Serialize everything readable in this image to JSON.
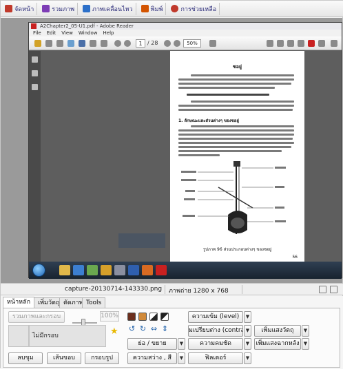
{
  "top_tabs": [
    {
      "label": "จัดหน้า",
      "icon": "layout-icon",
      "color": "#c0392b"
    },
    {
      "label": "รวมภาพ",
      "icon": "combine-icon",
      "color": "#7d3cb5"
    },
    {
      "label": "ภาพเคลื่อนไหว",
      "icon": "animation-icon",
      "color": "#2c70c9"
    },
    {
      "label": "พิมพ์",
      "icon": "print-icon",
      "color": "#d35400"
    },
    {
      "label": "การช่วยเหลือ",
      "icon": "help-icon",
      "color": "#c0392b"
    }
  ],
  "reader": {
    "title": "A2Chapter2_05-U1.pdf - Adobe Reader",
    "menu": [
      "File",
      "Edit",
      "View",
      "Window",
      "Help"
    ],
    "page_current": "1",
    "page_total": "/ 28",
    "zoom": "50%",
    "heading": "ซอยู่",
    "subheading": "1.  ลักษณะและส่วนต่างๆ ของซอยู่",
    "caption": "รูปภาพ 96 ส่วนประกอบต่างๆ ของซอยู่",
    "page_number": "56"
  },
  "info": {
    "filename": "capture-20130714-143330.png",
    "dimensions": "ภาพถ่าย 1280 x 768"
  },
  "bottom_tabs": [
    "หน้าหลัก",
    "เพิ่มวัตถุ",
    "ตัดภาพ",
    "Tools"
  ],
  "controls": {
    "merge_frame": "รวมภาพและกรอบ",
    "percent": "100%",
    "frame_select": "ไม่มีกรอบ",
    "erase": "ลบขุม",
    "border": "เส้นขอบ",
    "frame_shape": "กรอบรูป",
    "resize": "ย่อ / ขยาย",
    "brightness": "ความสว่าง , สี",
    "levels": "ความเข้ม (level)",
    "contrast": "มเปรียบต่าง (contra",
    "sharpness": "ความคมชัด",
    "filter": "ฟิลเตอร์",
    "add_object": "เพิ่มแสงวัตถุ",
    "add_background": "เพิ่มแสงฉากหลัง"
  },
  "colors": {
    "accent": "#2b2b7a",
    "taskbar": "#1e2a38",
    "page_bg": "#ffffff"
  }
}
